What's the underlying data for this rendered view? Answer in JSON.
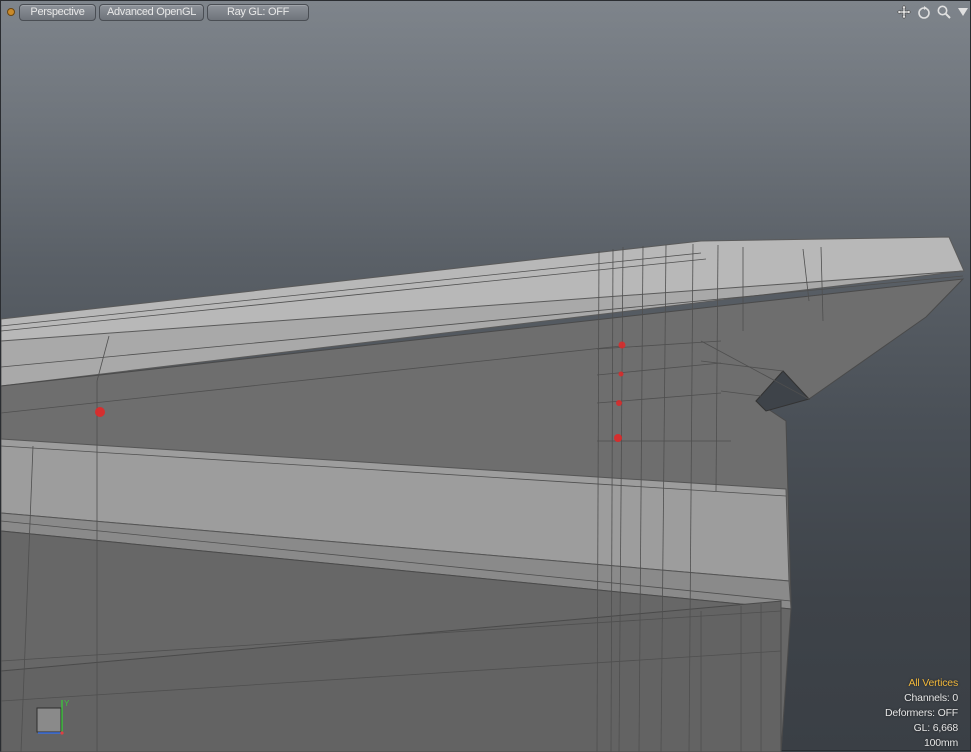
{
  "toolbar": {
    "view_mode": "Perspective",
    "shading_mode": "Advanced OpenGL",
    "raygl_status": "Ray GL: OFF"
  },
  "nav_icons": [
    "move-view-icon",
    "rotate-view-icon",
    "zoom-view-icon",
    "maximize-viewport-icon"
  ],
  "hud": {
    "selection_mode": "All Vertices",
    "channels": "Channels: 0",
    "deformers": "Deformers: OFF",
    "gl_count": "GL: 6,668",
    "grid_size": "100mm"
  },
  "axis": {
    "y_label": "Y",
    "x_color": "#e04040",
    "y_color": "#3ec23e",
    "z_color": "#3a6fe0"
  },
  "colors": {
    "accent": "#f0b73c",
    "vertex_highlight": "#e02828"
  }
}
